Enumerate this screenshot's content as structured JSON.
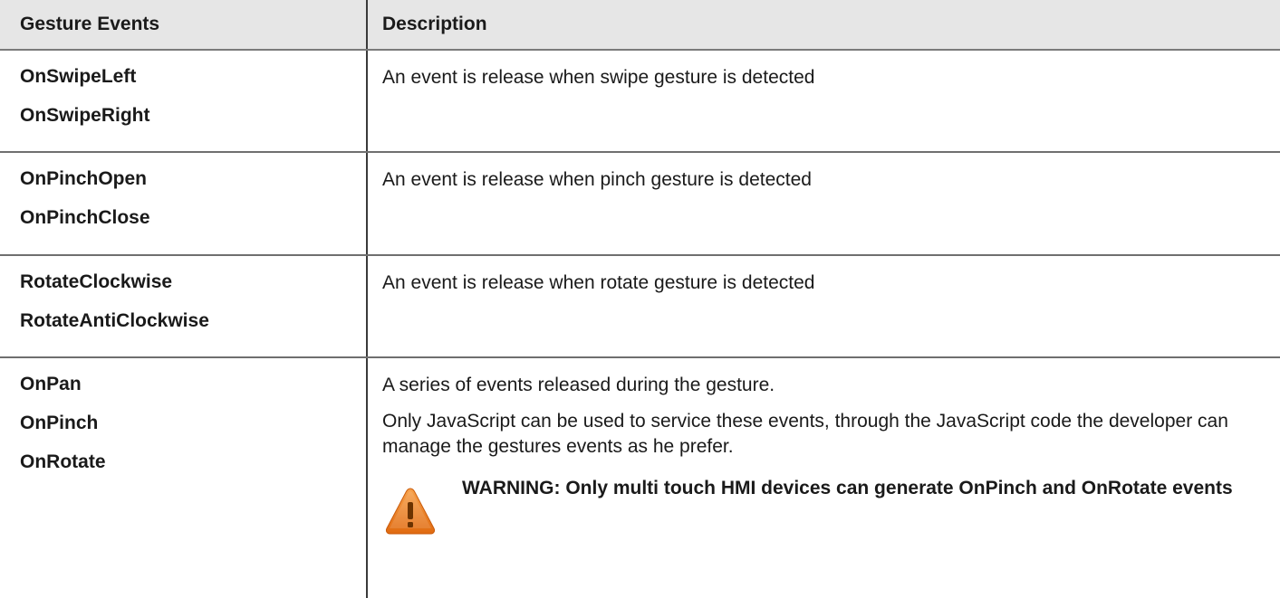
{
  "table": {
    "headers": {
      "events": "Gesture Events",
      "description": "Description"
    },
    "rows": [
      {
        "events": [
          "OnSwipeLeft",
          "OnSwipeRight"
        ],
        "description": [
          "An event is release when swipe gesture is detected"
        ]
      },
      {
        "events": [
          "OnPinchOpen",
          "OnPinchClose"
        ],
        "description": [
          "An event is release when pinch gesture is detected"
        ]
      },
      {
        "events": [
          "RotateClockwise",
          "RotateAntiClockwise"
        ],
        "description": [
          "An event is release when rotate gesture is detected"
        ]
      },
      {
        "events": [
          "OnPan",
          "OnPinch",
          "OnRotate"
        ],
        "description": [
          "A series of events released during the gesture.",
          "Only JavaScript can be used to service these events, through the JavaScript code the developer can manage the gestures events as he prefer."
        ],
        "warning": {
          "icon": "warning-triangle-icon",
          "text": "WARNING: Only multi touch HMI devices can generate OnPinch and OnRotate events"
        }
      }
    ]
  },
  "colors": {
    "header_bg": "#e6e6e6",
    "warning_orange": "#f07a1a"
  }
}
